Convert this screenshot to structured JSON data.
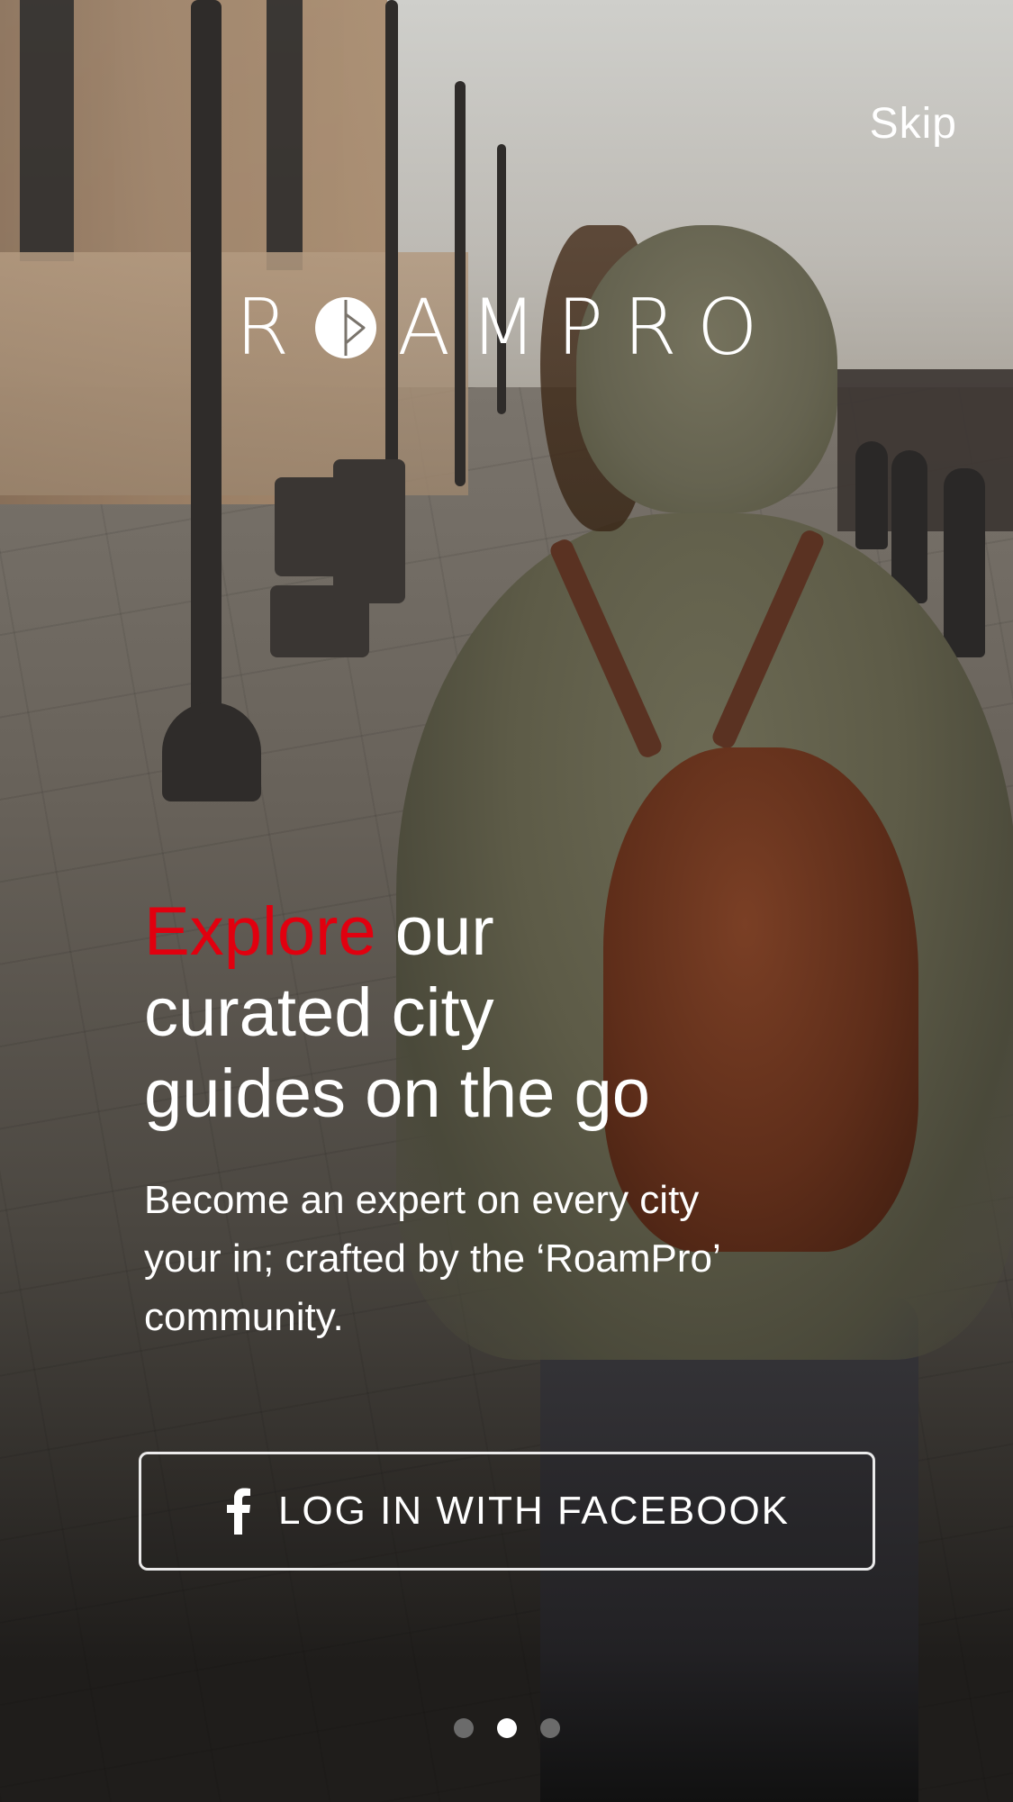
{
  "header": {
    "skip_label": "Skip"
  },
  "logo": {
    "text_before": "R",
    "text_after": "AMPRO",
    "icon": "roampro-compass-logo-icon"
  },
  "onboarding": {
    "headline_accent": "Explore",
    "headline_rest_1": " our",
    "headline_line_2": "curated city",
    "headline_line_3": "guides on the go",
    "subtext_line_1": "Become an expert on every city",
    "subtext_line_2": "your in; crafted by the ‘RoamPro’",
    "subtext_line_3": "community."
  },
  "login": {
    "facebook_label": "LOG IN WITH FACEBOOK",
    "facebook_icon": "facebook-icon"
  },
  "pager": {
    "total_pages": 3,
    "active_page": 2
  },
  "colors": {
    "accent": "#e1000f",
    "text": "#ffffff",
    "dot_inactive": "#6b6b6b",
    "dot_active": "#ffffff"
  }
}
